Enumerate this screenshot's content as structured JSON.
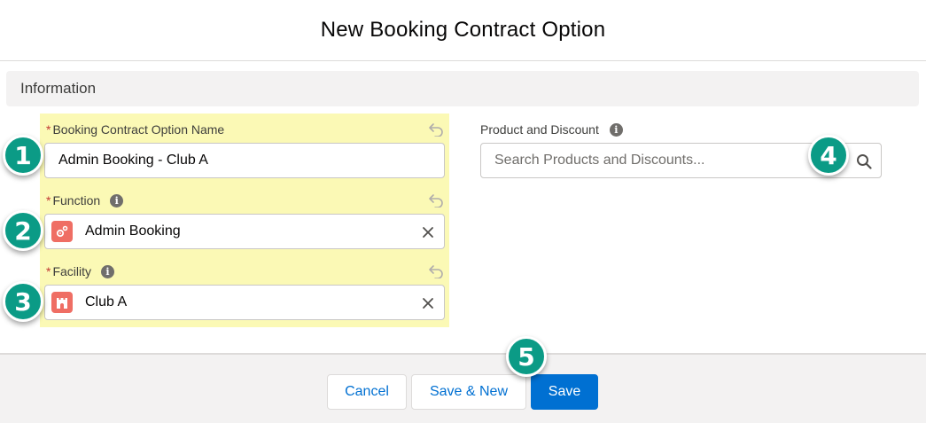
{
  "modal": {
    "title": "New Booking Contract Option"
  },
  "section": {
    "title": "Information"
  },
  "fields": {
    "name": {
      "label": "Booking Contract Option Name",
      "required_marker": "*",
      "value": "Admin Booking - Club A"
    },
    "function": {
      "label": "Function",
      "required_marker": "*",
      "value": "Admin Booking",
      "icon": "function-icon"
    },
    "facility": {
      "label": "Facility",
      "required_marker": "*",
      "value": "Club A",
      "icon": "facility-icon"
    },
    "product": {
      "label": "Product and Discount",
      "placeholder": "Search Products and Discounts...",
      "value": ""
    }
  },
  "info_icon_glyph": "i",
  "badges": [
    "1",
    "2",
    "3",
    "4",
    "5"
  ],
  "footer": {
    "cancel_label": "Cancel",
    "save_new_label": "Save & New",
    "save_label": "Save"
  },
  "colors": {
    "highlight": "#fbf9b5",
    "brand": "#0070d2",
    "badge": "#0b9b86",
    "required": "#c23934",
    "entity_icon": "#ef6e64"
  }
}
